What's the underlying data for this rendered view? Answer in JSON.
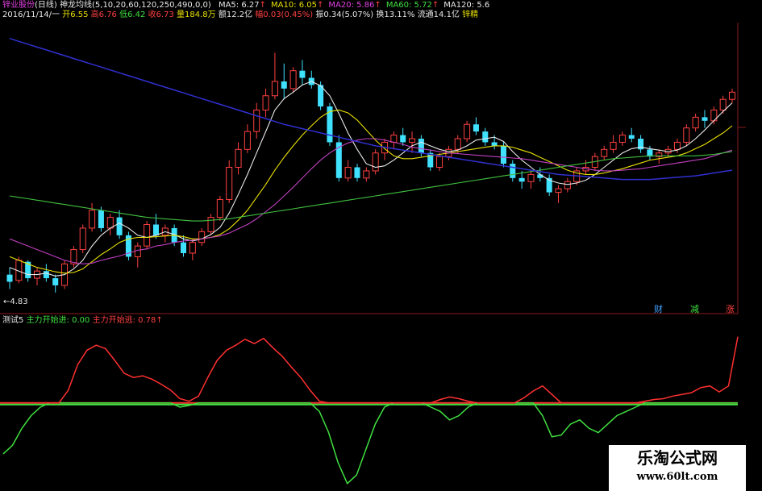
{
  "header": {
    "stock": "锌业股份",
    "period": "(日线)",
    "indicator": "神龙均线(5,10,20,60,120,250,490,0,0)",
    "ma": [
      {
        "label": "MA5: 6.27",
        "arrow": "↑",
        "color": "#e8e8e8"
      },
      {
        "label": "MA10: 6.05",
        "arrow": "↑",
        "color": "#e8e000"
      },
      {
        "label": "MA20: 5.86",
        "arrow": "↑",
        "color": "#e040e0"
      },
      {
        "label": "MA60: 5.72",
        "arrow": "↑",
        "color": "#40e040"
      },
      {
        "label": "MA120: 5.6",
        "arrow": "",
        "color": "#e8e8e8"
      }
    ]
  },
  "info": {
    "date": "2016/11/14/一",
    "open": "开6.55",
    "high": "高6.76",
    "low": "低6.42",
    "close": "收6.73",
    "volume": "量184.8万",
    "amount": "额12.2亿",
    "change": "幅0.03(0.45%)",
    "amplitude": "振0.34(5.07%)",
    "turnover": "换13.11%",
    "float": "流通14.1亿",
    "extra": "锌精"
  },
  "low_label": "4.83",
  "markers": [
    {
      "label": "财",
      "color": "#40a0ff"
    },
    {
      "label": "减",
      "color": "#40e040"
    },
    {
      "label": "涨",
      "color": "#ff4040"
    }
  ],
  "sub": {
    "name": "测试5",
    "in_label": "主力开始进: 0.00",
    "out_label": "主力开始逃: 0.78",
    "out_arrow": "↑"
  },
  "watermark": {
    "line1": "乐淘公式网",
    "line2": "www.60lt.com"
  },
  "colors": {
    "up": "#ff4040",
    "down": "#40e0ff",
    "ma5": "#e8e8e8",
    "ma10": "#e8e000",
    "ma20": "#c040c0",
    "ma60": "#40c040",
    "ma120": "#3030d0",
    "in_line": "#40e040",
    "out_line": "#ff3030"
  },
  "chart_data": [
    {
      "type": "candlestick",
      "title": "锌业股份 (日线)",
      "ylim": [
        4.6,
        8.6
      ],
      "candles": [
        [
          5.1,
          5.2,
          4.9,
          5.0
        ],
        [
          5.02,
          5.35,
          4.98,
          5.3
        ],
        [
          5.28,
          5.3,
          5.0,
          5.05
        ],
        [
          5.05,
          5.2,
          4.95,
          5.15
        ],
        [
          5.15,
          5.25,
          5.0,
          5.05
        ],
        [
          5.05,
          5.1,
          4.85,
          4.95
        ],
        [
          4.95,
          5.3,
          4.9,
          5.25
        ],
        [
          5.25,
          5.5,
          5.2,
          5.45
        ],
        [
          5.45,
          5.8,
          5.4,
          5.75
        ],
        [
          5.75,
          6.1,
          5.7,
          6.0
        ],
        [
          6.0,
          6.05,
          5.7,
          5.75
        ],
        [
          5.75,
          5.95,
          5.65,
          5.9
        ],
        [
          5.9,
          6.0,
          5.6,
          5.65
        ],
        [
          5.65,
          5.7,
          5.3,
          5.35
        ],
        [
          5.35,
          5.55,
          5.2,
          5.5
        ],
        [
          5.5,
          5.85,
          5.45,
          5.8
        ],
        [
          5.8,
          5.95,
          5.6,
          5.65
        ],
        [
          5.65,
          5.8,
          5.55,
          5.75
        ],
        [
          5.75,
          5.8,
          5.5,
          5.55
        ],
        [
          5.55,
          5.65,
          5.35,
          5.4
        ],
        [
          5.4,
          5.6,
          5.3,
          5.55
        ],
        [
          5.55,
          5.75,
          5.5,
          5.7
        ],
        [
          5.7,
          5.95,
          5.65,
          5.9
        ],
        [
          5.9,
          6.2,
          5.85,
          6.15
        ],
        [
          6.15,
          6.7,
          6.1,
          6.6
        ],
        [
          6.6,
          6.95,
          6.5,
          6.85
        ],
        [
          6.85,
          7.2,
          6.8,
          7.1
        ],
        [
          7.1,
          7.5,
          7.0,
          7.4
        ],
        [
          7.4,
          7.7,
          7.3,
          7.6
        ],
        [
          7.6,
          8.2,
          7.55,
          7.8
        ],
        [
          7.8,
          8.05,
          7.55,
          7.7
        ],
        [
          7.7,
          8.0,
          7.65,
          7.95
        ],
        [
          7.95,
          8.1,
          7.75,
          7.85
        ],
        [
          7.85,
          7.95,
          7.7,
          7.75
        ],
        [
          7.75,
          7.8,
          7.4,
          7.45
        ],
        [
          7.45,
          7.5,
          6.9,
          6.95
        ],
        [
          6.95,
          7.05,
          6.4,
          6.45
        ],
        [
          6.45,
          6.7,
          6.4,
          6.6
        ],
        [
          6.6,
          6.65,
          6.4,
          6.45
        ],
        [
          6.45,
          6.6,
          6.4,
          6.55
        ],
        [
          6.55,
          6.85,
          6.5,
          6.8
        ],
        [
          6.8,
          7.0,
          6.7,
          6.95
        ],
        [
          6.95,
          7.1,
          6.85,
          7.05
        ],
        [
          7.05,
          7.15,
          6.9,
          6.95
        ],
        [
          6.95,
          7.1,
          6.8,
          7.0
        ],
        [
          7.0,
          7.05,
          6.75,
          6.8
        ],
        [
          6.8,
          6.85,
          6.55,
          6.6
        ],
        [
          6.6,
          6.8,
          6.55,
          6.75
        ],
        [
          6.75,
          6.9,
          6.7,
          6.85
        ],
        [
          6.85,
          7.05,
          6.8,
          7.0
        ],
        [
          7.0,
          7.25,
          6.95,
          7.2
        ],
        [
          7.2,
          7.3,
          7.05,
          7.1
        ],
        [
          7.1,
          7.15,
          6.9,
          6.95
        ],
        [
          6.95,
          7.05,
          6.85,
          6.9
        ],
        [
          6.9,
          6.95,
          6.6,
          6.65
        ],
        [
          6.65,
          6.7,
          6.4,
          6.45
        ],
        [
          6.45,
          6.55,
          6.3,
          6.4
        ],
        [
          6.4,
          6.55,
          6.3,
          6.5
        ],
        [
          6.5,
          6.6,
          6.4,
          6.45
        ],
        [
          6.45,
          6.5,
          6.2,
          6.25
        ],
        [
          6.25,
          6.35,
          6.1,
          6.3
        ],
        [
          6.3,
          6.45,
          6.25,
          6.4
        ],
        [
          6.4,
          6.6,
          6.35,
          6.55
        ],
        [
          6.55,
          6.7,
          6.5,
          6.6
        ],
        [
          6.6,
          6.8,
          6.55,
          6.75
        ],
        [
          6.75,
          6.9,
          6.7,
          6.85
        ],
        [
          6.85,
          7.05,
          6.8,
          6.95
        ],
        [
          6.95,
          7.1,
          6.9,
          7.05
        ],
        [
          7.05,
          7.15,
          6.95,
          7.0
        ],
        [
          7.0,
          7.05,
          6.8,
          6.85
        ],
        [
          6.85,
          6.9,
          6.7,
          6.75
        ],
        [
          6.75,
          6.85,
          6.65,
          6.8
        ],
        [
          6.8,
          6.9,
          6.75,
          6.85
        ],
        [
          6.85,
          7.0,
          6.8,
          6.95
        ],
        [
          6.95,
          7.2,
          6.9,
          7.15
        ],
        [
          7.15,
          7.35,
          7.1,
          7.3
        ],
        [
          7.3,
          7.4,
          7.15,
          7.25
        ],
        [
          7.25,
          7.45,
          7.2,
          7.4
        ],
        [
          7.4,
          7.6,
          7.35,
          7.55
        ],
        [
          7.55,
          7.7,
          7.5,
          7.65
        ]
      ],
      "series": [
        {
          "name": "MA5",
          "values": [
            5.2,
            5.15,
            5.1,
            5.1,
            5.12,
            5.08,
            5.1,
            5.18,
            5.3,
            5.5,
            5.65,
            5.75,
            5.82,
            5.75,
            5.65,
            5.62,
            5.65,
            5.7,
            5.66,
            5.6,
            5.57,
            5.6,
            5.66,
            5.76,
            5.96,
            6.22,
            6.5,
            6.8,
            7.1,
            7.4,
            7.56,
            7.65,
            7.75,
            7.8,
            7.74,
            7.6,
            7.35,
            7.08,
            6.85,
            6.65,
            6.6,
            6.62,
            6.7,
            6.8,
            6.9,
            6.95,
            6.9,
            6.85,
            6.82,
            6.84,
            6.9,
            6.98,
            7.0,
            7.02,
            6.96,
            6.82,
            6.7,
            6.6,
            6.5,
            6.42,
            6.38,
            6.36,
            6.38,
            6.42,
            6.5,
            6.6,
            6.7,
            6.8,
            6.86,
            6.88,
            6.86,
            6.84,
            6.82,
            6.84,
            6.9,
            7.0,
            7.12,
            7.25,
            7.38,
            7.5
          ]
        },
        {
          "name": "MA10",
          "values": [
            5.35,
            5.3,
            5.25,
            5.2,
            5.17,
            5.14,
            5.12,
            5.13,
            5.18,
            5.28,
            5.38,
            5.46,
            5.55,
            5.6,
            5.62,
            5.62,
            5.63,
            5.64,
            5.65,
            5.63,
            5.6,
            5.6,
            5.62,
            5.66,
            5.74,
            5.86,
            6.0,
            6.18,
            6.36,
            6.56,
            6.74,
            6.9,
            7.05,
            7.18,
            7.3,
            7.38,
            7.4,
            7.36,
            7.26,
            7.12,
            6.98,
            6.86,
            6.76,
            6.72,
            6.72,
            6.74,
            6.76,
            6.78,
            6.8,
            6.82,
            6.84,
            6.86,
            6.88,
            6.9,
            6.9,
            6.88,
            6.84,
            6.8,
            6.74,
            6.68,
            6.62,
            6.56,
            6.52,
            6.5,
            6.5,
            6.52,
            6.55,
            6.58,
            6.62,
            6.66,
            6.7,
            6.72,
            6.74,
            6.76,
            6.8,
            6.86,
            6.92,
            7.0,
            7.08,
            7.18
          ]
        },
        {
          "name": "MA20",
          "values": [
            5.6,
            5.55,
            5.5,
            5.45,
            5.4,
            5.35,
            5.3,
            5.27,
            5.25,
            5.26,
            5.3,
            5.33,
            5.36,
            5.4,
            5.44,
            5.46,
            5.5,
            5.52,
            5.55,
            5.57,
            5.58,
            5.6,
            5.62,
            5.64,
            5.68,
            5.74,
            5.8,
            5.88,
            5.98,
            6.08,
            6.2,
            6.32,
            6.45,
            6.58,
            6.7,
            6.8,
            6.88,
            6.94,
            6.98,
            7.0,
            7.0,
            6.98,
            6.95,
            6.92,
            6.88,
            6.86,
            6.84,
            6.82,
            6.8,
            6.79,
            6.78,
            6.77,
            6.76,
            6.75,
            6.74,
            6.73,
            6.72,
            6.7,
            6.68,
            6.66,
            6.64,
            6.62,
            6.6,
            6.58,
            6.56,
            6.55,
            6.55,
            6.56,
            6.57,
            6.58,
            6.6,
            6.62,
            6.64,
            6.66,
            6.68,
            6.7,
            6.72,
            6.76,
            6.8,
            6.84
          ]
        },
        {
          "name": "MA60",
          "values": [
            6.2,
            6.18,
            6.16,
            6.14,
            6.12,
            6.1,
            6.08,
            6.06,
            6.04,
            6.02,
            6.0,
            5.98,
            5.96,
            5.94,
            5.92,
            5.9,
            5.89,
            5.88,
            5.87,
            5.86,
            5.85,
            5.85,
            5.86,
            5.87,
            5.88,
            5.9,
            5.92,
            5.94,
            5.96,
            5.98,
            6.0,
            6.02,
            6.04,
            6.06,
            6.08,
            6.1,
            6.12,
            6.14,
            6.16,
            6.18,
            6.2,
            6.22,
            6.24,
            6.26,
            6.28,
            6.3,
            6.32,
            6.34,
            6.36,
            6.38,
            6.4,
            6.42,
            6.44,
            6.46,
            6.48,
            6.5,
            6.52,
            6.54,
            6.56,
            6.58,
            6.6,
            6.62,
            6.64,
            6.66,
            6.68,
            6.7,
            6.72,
            6.73,
            6.74,
            6.75,
            6.76,
            6.76,
            6.76,
            6.76,
            6.76,
            6.76,
            6.77,
            6.78,
            6.8,
            6.82
          ]
        },
        {
          "name": "MA120",
          "values": [
            8.4,
            8.36,
            8.32,
            8.28,
            8.24,
            8.2,
            8.16,
            8.12,
            8.08,
            8.04,
            8.0,
            7.96,
            7.92,
            7.88,
            7.84,
            7.8,
            7.76,
            7.72,
            7.68,
            7.64,
            7.6,
            7.56,
            7.52,
            7.48,
            7.44,
            7.4,
            7.36,
            7.32,
            7.28,
            7.24,
            7.2,
            7.17,
            7.14,
            7.11,
            7.08,
            7.05,
            7.02,
            6.99,
            6.96,
            6.93,
            6.9,
            6.88,
            6.86,
            6.84,
            6.82,
            6.8,
            6.78,
            6.76,
            6.74,
            6.72,
            6.7,
            6.68,
            6.66,
            6.64,
            6.62,
            6.6,
            6.58,
            6.56,
            6.54,
            6.52,
            6.5,
            6.49,
            6.48,
            6.47,
            6.46,
            6.45,
            6.44,
            6.43,
            6.43,
            6.43,
            6.43,
            6.44,
            6.45,
            6.46,
            6.47,
            6.48,
            6.5,
            6.52,
            6.54,
            6.56
          ]
        }
      ]
    },
    {
      "type": "line",
      "title": "测试5",
      "ylim": [
        -1.0,
        0.9
      ],
      "baseline": 0,
      "series": [
        {
          "name": "主力开始逃",
          "values": [
            0,
            0,
            0,
            0,
            0,
            0,
            0,
            0.15,
            0.45,
            0.62,
            0.68,
            0.64,
            0.5,
            0.35,
            0.3,
            0.32,
            0.28,
            0.22,
            0.15,
            0.05,
            0.02,
            0.08,
            0.3,
            0.5,
            0.62,
            0.68,
            0.75,
            0.7,
            0.76,
            0.65,
            0.55,
            0.42,
            0.3,
            0.15,
            0.02,
            0,
            0,
            0,
            0,
            0,
            0,
            0,
            0,
            0,
            0,
            0,
            0,
            0.04,
            0.07,
            0.05,
            0.02,
            0,
            0,
            0,
            0,
            0,
            0.06,
            0.14,
            0.2,
            0.1,
            0,
            0,
            0,
            0,
            0,
            0,
            0,
            0,
            0,
            0.02,
            0.04,
            0.05,
            0.08,
            0.1,
            0.12,
            0.18,
            0.2,
            0.13,
            0.2,
            0.78
          ]
        },
        {
          "name": "主力开始进",
          "values": [
            -0.6,
            -0.5,
            -0.3,
            -0.15,
            -0.05,
            0,
            0,
            0,
            0,
            0,
            0,
            0,
            0,
            0,
            0,
            0,
            0,
            0,
            0,
            -0.05,
            -0.03,
            0,
            0,
            0,
            0,
            0,
            0,
            0,
            0,
            0,
            0,
            0,
            0,
            0,
            -0.1,
            -0.35,
            -0.7,
            -0.95,
            -0.85,
            -0.55,
            -0.25,
            -0.05,
            0,
            0,
            0,
            0,
            -0.05,
            -0.1,
            -0.2,
            -0.15,
            -0.05,
            0,
            0,
            0,
            0,
            0,
            0,
            0,
            -0.15,
            -0.4,
            -0.38,
            -0.25,
            -0.2,
            -0.3,
            -0.35,
            -0.25,
            -0.15,
            -0.1,
            -0.05,
            0,
            0,
            0,
            0,
            0,
            0,
            0,
            0,
            0,
            0,
            0
          ]
        }
      ]
    }
  ]
}
